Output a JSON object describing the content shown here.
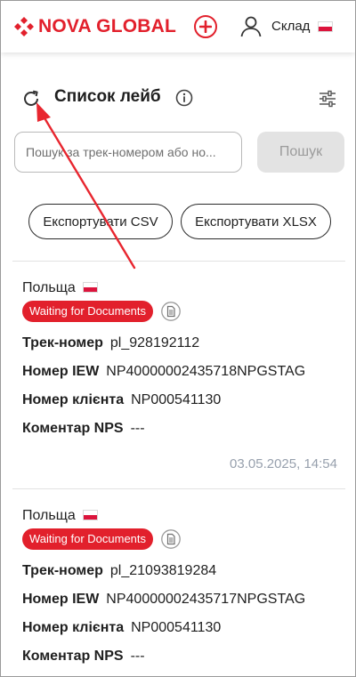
{
  "header": {
    "brand": "NOVA GLOBAL",
    "warehouse_label": "Склад"
  },
  "page": {
    "title": "Список лейб"
  },
  "search": {
    "placeholder": "Пошук за трек-номером або но...",
    "button_label": "Пошук"
  },
  "export": {
    "csv_label": "Експортувати CSV",
    "xlsx_label": "Експортувати XLSX"
  },
  "labels": {
    "track": "Трек-номер",
    "iew": "Номер IEW",
    "client": "Номер клієнта",
    "comment": "Коментар NPS"
  },
  "items": [
    {
      "country": "Польща",
      "status": "Waiting for Documents",
      "track": "pl_928192112",
      "iew": "NP40000002435718NPGSTAG",
      "client": "NP000541130",
      "comment": "---",
      "date": "03.05.2025, 14:54"
    },
    {
      "country": "Польща",
      "status": "Waiting for Documents",
      "track": "pl_21093819284",
      "iew": "NP40000002435717NPGSTAG",
      "client": "NP000541130",
      "comment": "---"
    }
  ],
  "colors": {
    "brand_red": "#e2202c",
    "muted_date": "#97a0ad",
    "annotation_arrow": "#e8262f"
  },
  "icons": [
    "logo-mark-icon",
    "plus-circle-icon",
    "user-icon",
    "poland-flag-icon",
    "refresh-icon",
    "info-icon",
    "filter-sliders-icon",
    "document-icon",
    "annotation-arrow"
  ]
}
